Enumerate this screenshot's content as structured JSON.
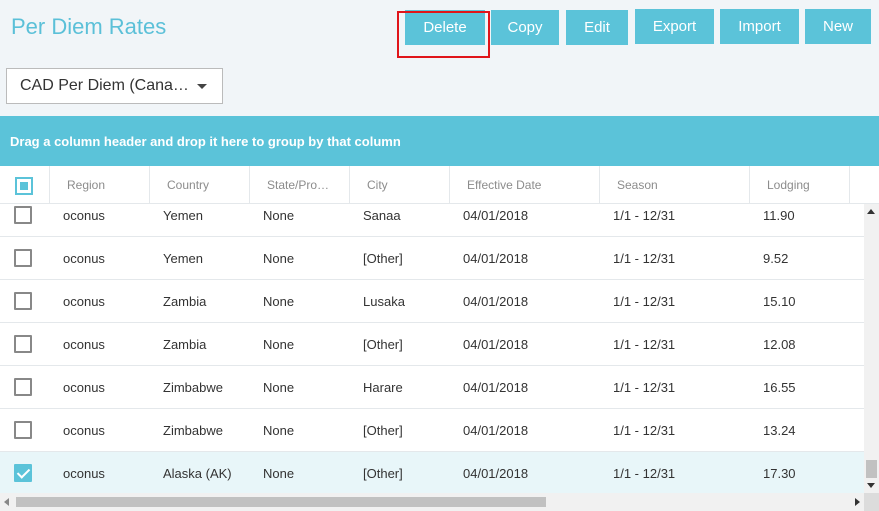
{
  "page": {
    "title": "Per Diem Rates"
  },
  "toolbar": {
    "delete_label": "Delete",
    "copy_label": "Copy",
    "edit_label": "Edit",
    "export_label": "Export",
    "import_label": "Import",
    "new_label": "New"
  },
  "selector": {
    "value": "CAD Per Diem (Cana…"
  },
  "group_bar": {
    "text": "Drag a column header and drop it here to group by that column"
  },
  "grid": {
    "columns": [
      "Region",
      "Country",
      "State/Pro…",
      "City",
      "Effective Date",
      "Season",
      "Lodging"
    ],
    "rows": [
      {
        "checked": false,
        "region": "oconus",
        "country": "Yemen",
        "state": "None",
        "city": "Sanaa",
        "effective_date": "04/01/2018",
        "season": "1/1 - 12/31",
        "lodging": "11.90"
      },
      {
        "checked": false,
        "region": "oconus",
        "country": "Yemen",
        "state": "None",
        "city": "[Other]",
        "effective_date": "04/01/2018",
        "season": "1/1 - 12/31",
        "lodging": "9.52"
      },
      {
        "checked": false,
        "region": "oconus",
        "country": "Zambia",
        "state": "None",
        "city": "Lusaka",
        "effective_date": "04/01/2018",
        "season": "1/1 - 12/31",
        "lodging": "15.10"
      },
      {
        "checked": false,
        "region": "oconus",
        "country": "Zambia",
        "state": "None",
        "city": "[Other]",
        "effective_date": "04/01/2018",
        "season": "1/1 - 12/31",
        "lodging": "12.08"
      },
      {
        "checked": false,
        "region": "oconus",
        "country": "Zimbabwe",
        "state": "None",
        "city": "Harare",
        "effective_date": "04/01/2018",
        "season": "1/1 - 12/31",
        "lodging": "16.55"
      },
      {
        "checked": false,
        "region": "oconus",
        "country": "Zimbabwe",
        "state": "None",
        "city": "[Other]",
        "effective_date": "04/01/2018",
        "season": "1/1 - 12/31",
        "lodging": "13.24"
      },
      {
        "checked": true,
        "region": "oconus",
        "country": "Alaska (AK)",
        "state": "None",
        "city": "[Other]",
        "effective_date": "04/01/2018",
        "season": "1/1 - 12/31",
        "lodging": "17.30"
      }
    ]
  },
  "colors": {
    "accent": "#5bc3d9",
    "title": "#5bc0d8",
    "highlight": "#e0151a",
    "selected_row": "#e8f6f9"
  }
}
